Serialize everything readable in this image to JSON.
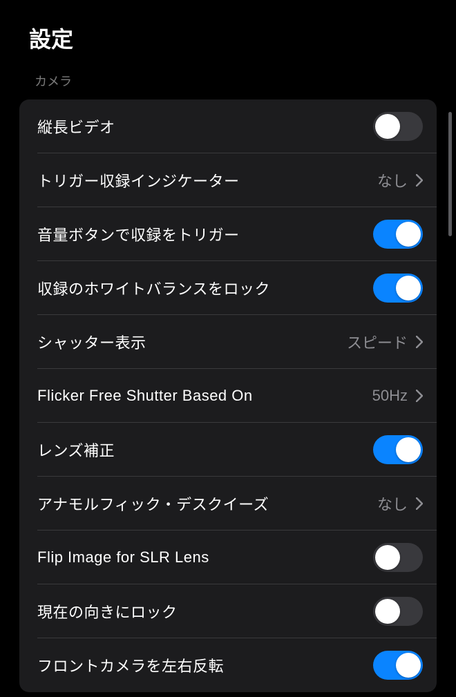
{
  "header": {
    "title": "設定"
  },
  "section": {
    "label": "カメラ"
  },
  "rows": [
    {
      "label": "縦長ビデオ",
      "type": "toggle",
      "on": false
    },
    {
      "label": "トリガー収録インジケーター",
      "type": "link",
      "value": "なし"
    },
    {
      "label": "音量ボタンで収録をトリガー",
      "type": "toggle",
      "on": true
    },
    {
      "label": "収録のホワイトバランスをロック",
      "type": "toggle",
      "on": true
    },
    {
      "label": "シャッター表示",
      "type": "link",
      "value": "スピード"
    },
    {
      "label": "Flicker Free Shutter Based On",
      "type": "link",
      "value": "50Hz"
    },
    {
      "label": "レンズ補正",
      "type": "toggle",
      "on": true
    },
    {
      "label": "アナモルフィック・デスクイーズ",
      "type": "link",
      "value": "なし"
    },
    {
      "label": "Flip Image for SLR Lens",
      "type": "toggle",
      "on": false
    },
    {
      "label": "現在の向きにロック",
      "type": "toggle",
      "on": false
    },
    {
      "label": "フロントカメラを左右反転",
      "type": "toggle",
      "on": true
    }
  ]
}
